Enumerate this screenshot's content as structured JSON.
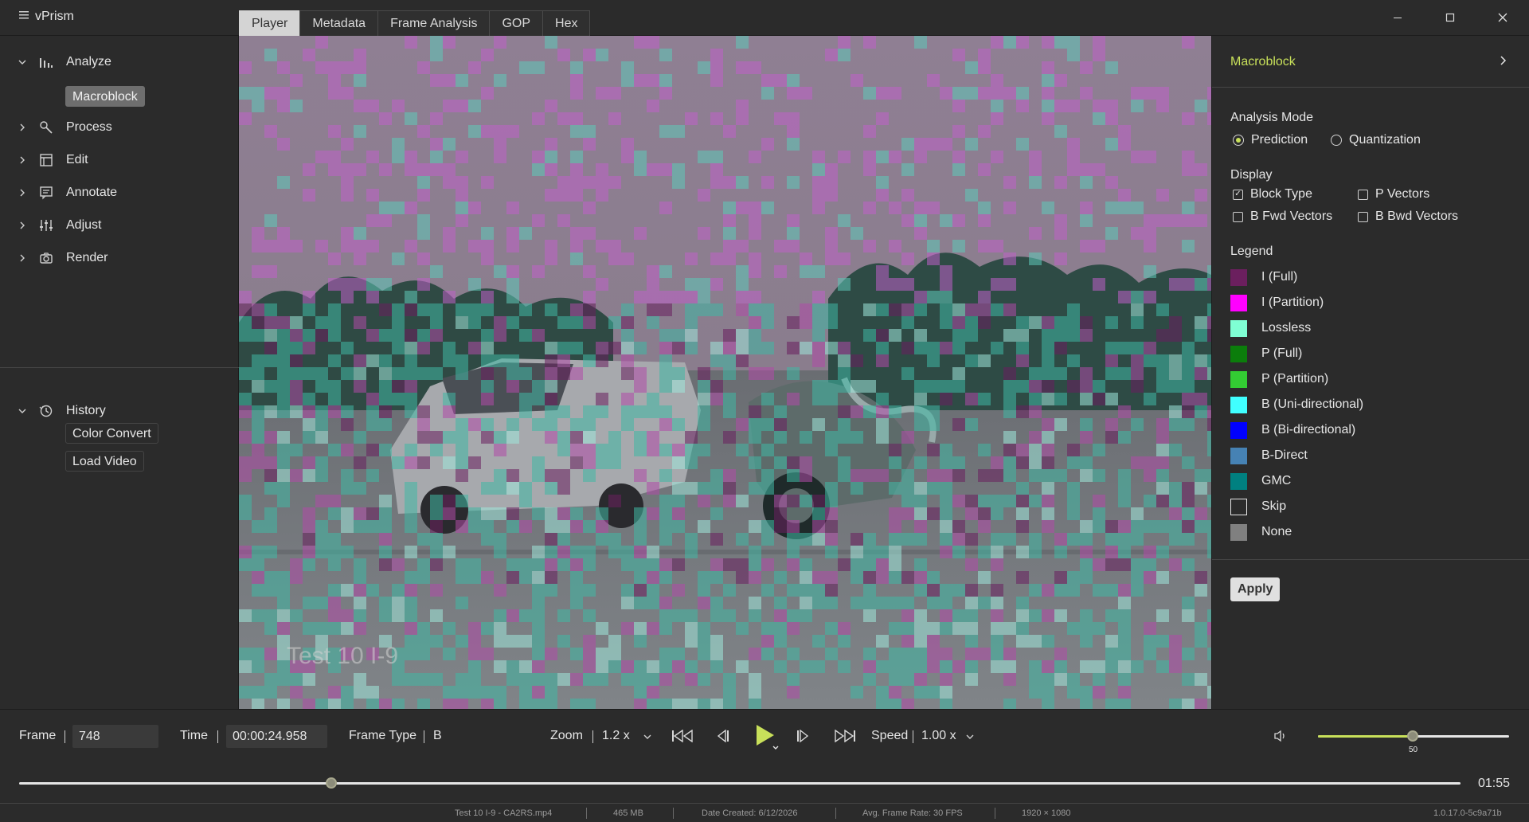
{
  "app": {
    "title": "vPrism"
  },
  "tabs": [
    "Player",
    "Metadata",
    "Frame Analysis",
    "GOP",
    "Hex"
  ],
  "active_tab": "Player",
  "sidebar": {
    "analyze_label": "Analyze",
    "macroblock_chip": "Macroblock",
    "process_label": "Process",
    "edit_label": "Edit",
    "annotate_label": "Annotate",
    "adjust_label": "Adjust",
    "render_label": "Render",
    "history_label": "History",
    "history_items": [
      "Color Convert",
      "Load Video"
    ]
  },
  "video": {
    "overlay_text": "Test 10 I-9"
  },
  "panel": {
    "title": "Macroblock",
    "analysis_mode_title": "Analysis Mode",
    "mode_prediction": "Prediction",
    "mode_quantization": "Quantization",
    "selected_mode": "Prediction",
    "display_title": "Display",
    "display_options": [
      {
        "label": "Block Type",
        "checked": true
      },
      {
        "label": "P Vectors",
        "checked": false
      },
      {
        "label": "B Fwd Vectors",
        "checked": false
      },
      {
        "label": "B Bwd Vectors",
        "checked": false
      }
    ],
    "legend_title": "Legend",
    "legend": [
      {
        "label": "I (Full)",
        "color": "#6b1f5e"
      },
      {
        "label": "I (Partition)",
        "color": "#ff00ff"
      },
      {
        "label": "Lossless",
        "color": "#7fffd4"
      },
      {
        "label": "P (Full)",
        "color": "#0b7d0b"
      },
      {
        "label": "P (Partition)",
        "color": "#33cc33"
      },
      {
        "label": "B (Uni-directional)",
        "color": "#40ffff"
      },
      {
        "label": "B (Bi-directional)",
        "color": "#0000ff"
      },
      {
        "label": "B-Direct",
        "color": "#4682b4"
      },
      {
        "label": "GMC",
        "color": "#008080"
      },
      {
        "label": "Skip",
        "color": "#2b2b2b"
      },
      {
        "label": "None",
        "color": "#808080"
      }
    ],
    "apply_label": "Apply"
  },
  "controls": {
    "frame_label": "Frame",
    "frame_value": "748",
    "time_label": "Time",
    "time_value": "00:00:24.958",
    "frame_type_label": "Frame Type",
    "frame_type_value": "B",
    "zoom_label": "Zoom",
    "zoom_value": "1.2 x",
    "speed_label": "Speed",
    "speed_value": "1.00 x",
    "volume": 50,
    "volume_label": "50",
    "playback_progress": 0.217,
    "duration": "01:55"
  },
  "status": {
    "file": "Test 10 I-9 - CA2RS.mp4",
    "size": "465 MB",
    "date_created": "Date Created: 6/12/2026",
    "frame_rate": "Avg. Frame Rate: 30 FPS",
    "resolution": "1920 × 1080",
    "version": "1.0.17.0-5c9a71b"
  },
  "accent_color": "#c8e05a"
}
